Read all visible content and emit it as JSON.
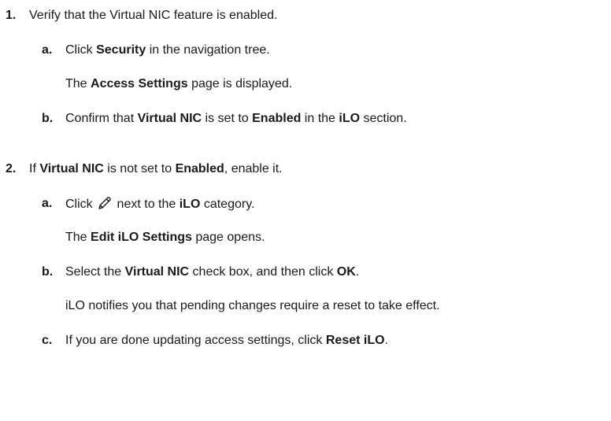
{
  "steps": [
    {
      "number": "1.",
      "text": "Verify that the Virtual NIC feature is enabled.",
      "substeps": [
        {
          "letter": "a.",
          "parts": [
            "Click ",
            "Security",
            " in the navigation tree."
          ],
          "note": [
            "The ",
            "Access Settings",
            " page is displayed."
          ]
        },
        {
          "letter": "b.",
          "parts": [
            "Confirm that ",
            "Virtual NIC",
            " is set to ",
            "Enabled",
            " in the ",
            "iLO",
            " section."
          ]
        }
      ]
    },
    {
      "number": "2.",
      "parts": [
        "If ",
        "Virtual NIC",
        " is not set to ",
        "Enabled",
        ", enable it."
      ],
      "substeps": [
        {
          "letter": "a.",
          "parts": [
            "Click ",
            " next to the ",
            "iLO",
            " category."
          ],
          "icon": "pencil-edit-icon",
          "note": [
            "The ",
            "Edit iLO Settings",
            " page opens."
          ]
        },
        {
          "letter": "b.",
          "parts": [
            "Select the ",
            "Virtual NIC",
            " check box, and then click ",
            "OK",
            "."
          ],
          "note_plain": "iLO notifies you that pending changes require a reset to take effect."
        },
        {
          "letter": "c.",
          "parts": [
            "If you are done updating access settings, click ",
            "Reset iLO",
            "."
          ]
        }
      ]
    }
  ]
}
